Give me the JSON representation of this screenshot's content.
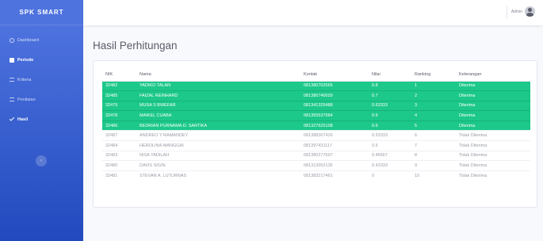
{
  "brand": "SPK  SMART",
  "sidebar": {
    "items": [
      {
        "label": "Dashboard",
        "icon": "dashboard-icon"
      },
      {
        "label": "Periode",
        "icon": "period-icon"
      },
      {
        "label": "Kriteria",
        "icon": "criteria-icon"
      },
      {
        "label": "Penilaian",
        "icon": "assessment-icon"
      },
      {
        "label": "Hasil",
        "icon": "check-icon"
      }
    ],
    "toggle": "‹"
  },
  "topbar": {
    "user": "Admin"
  },
  "page": {
    "title": "Hasil Perhitungan"
  },
  "colors": {
    "sidebar": "#4e73df",
    "accepted_row": "#1cc88a"
  },
  "table": {
    "headers": [
      "NIK",
      "Nama",
      "Kontak",
      "Nilai",
      "Ranking",
      "Keterangan"
    ],
    "rows": [
      [
        "32482",
        "YADIKO TALAN",
        "081380702565",
        "0.8",
        "1",
        "Diterima"
      ],
      [
        "32485",
        "FAIZAL REINHARD",
        "081386740029",
        "0.7",
        "2",
        "Diterima"
      ],
      [
        "32479",
        "MUSA S BWEFAR",
        "081341325488",
        "0.63333",
        "3",
        "Diterima"
      ],
      [
        "32478",
        "MAIKEL CUABA",
        "081355537964",
        "0.6",
        "4",
        "Diterima"
      ],
      [
        "32486",
        "BEDRIAN PURNAMA D. SARTIKA",
        "081327625108",
        "0.6",
        "5",
        "Diterima"
      ],
      [
        "32487",
        "ANDREO Y RAMANDEY",
        "081388307426",
        "0.53333",
        "6",
        "Tidak Diterima"
      ],
      [
        "32484",
        "HEROLINA WANGGAI",
        "081397431117",
        "0.5",
        "7",
        "Tidak Diterima"
      ],
      [
        "32483",
        "NISA YADILAH",
        "081380277697",
        "0.46667",
        "8",
        "Tidak Diterima"
      ],
      [
        "32480",
        "DAVIS SIGIN",
        "081313052135",
        "0.43333",
        "9",
        "Tidak Diterima"
      ],
      [
        "32481",
        "STEVAN A. LUTURNAS",
        "081383217461",
        "0",
        "10",
        "Tidak Diterima"
      ]
    ]
  }
}
